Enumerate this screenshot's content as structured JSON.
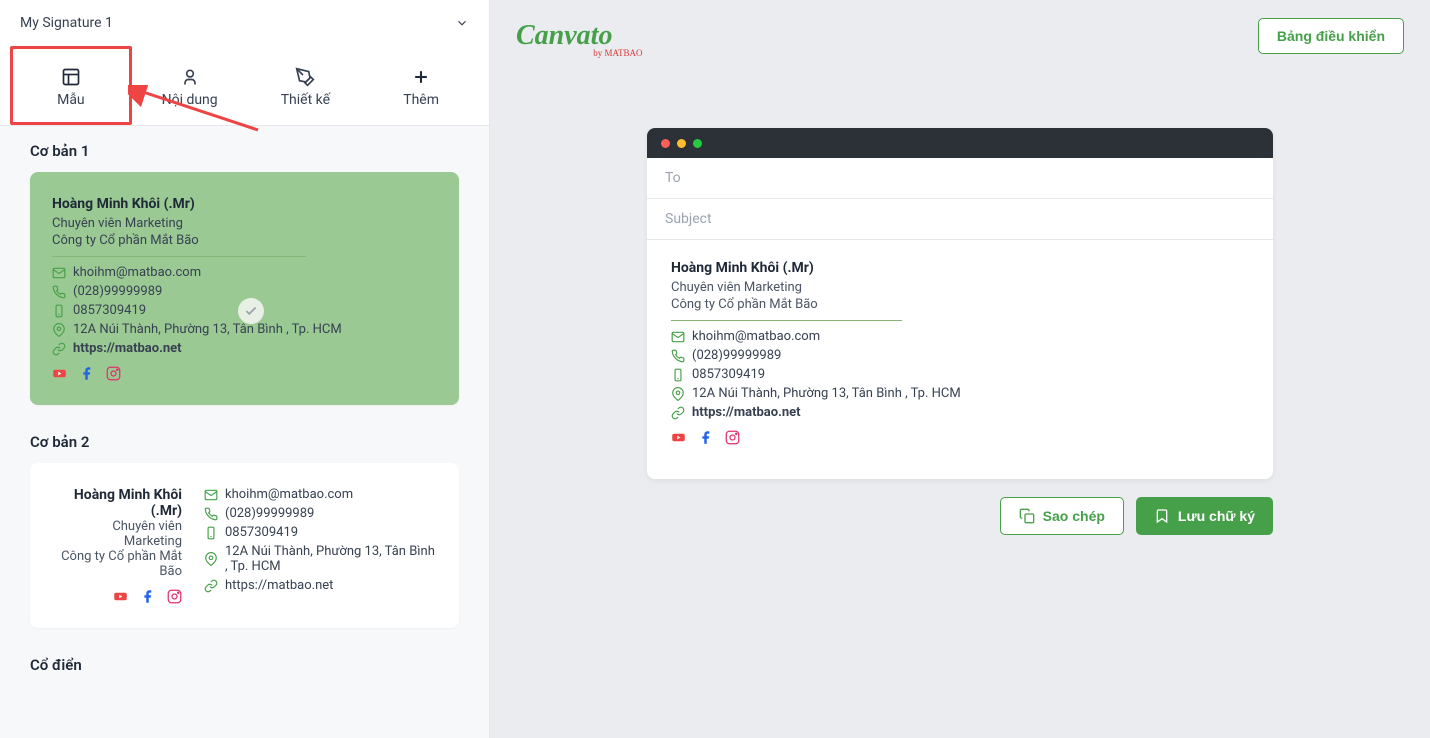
{
  "signature_select": {
    "label": "My Signature 1"
  },
  "tabs": [
    {
      "label": "Mẫu"
    },
    {
      "label": "Nội dung"
    },
    {
      "label": "Thiết kế"
    },
    {
      "label": "Thêm"
    }
  ],
  "templates": {
    "section1_title": "Cơ bản 1",
    "section2_title": "Cơ bản 2",
    "section3_title": "Cổ điển"
  },
  "signature": {
    "name": "Hoàng Minh Khôi (.Mr)",
    "title": "Chuyên viên Marketing",
    "company": "Công ty Cổ phần Mắt Bão",
    "email": "khoihm@matbao.com",
    "phone": "(028)99999989",
    "mobile": "0857309419",
    "address": "12A Núi Thành, Phường 13, Tân Bình , Tp. HCM",
    "website": "https://matbao.net"
  },
  "logo": {
    "main": "Canvato",
    "sub": "by MATBAO"
  },
  "dashboard_btn": "Bảng điều khiển",
  "email": {
    "to": "To",
    "subject": "Subject"
  },
  "buttons": {
    "copy": "Sao chép",
    "save": "Lưu chữ ký"
  }
}
